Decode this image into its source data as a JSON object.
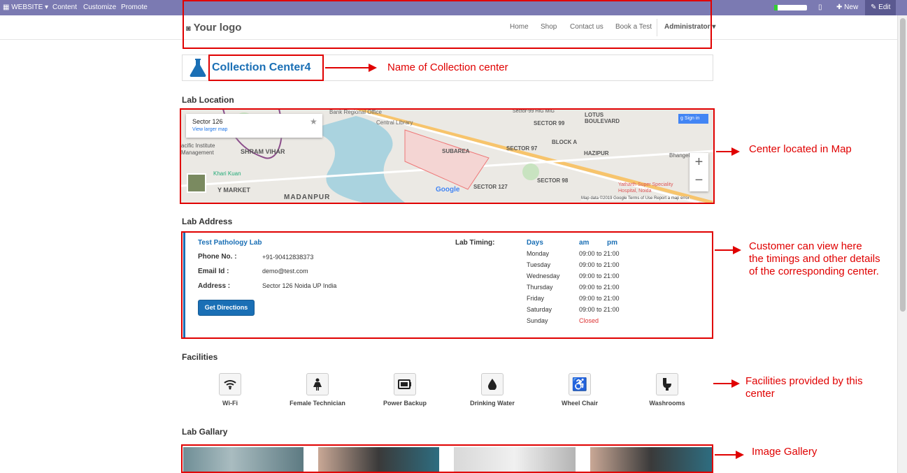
{
  "topbar": {
    "website": "WEBSITE",
    "content": "Content",
    "customize": "Customize",
    "promote": "Promote",
    "new": "New",
    "edit": "Edit"
  },
  "navbar": {
    "logo": "Your logo",
    "links": [
      "Home",
      "Shop",
      "Contact us",
      "Book a Test"
    ],
    "user": "Administrator"
  },
  "center": {
    "name": "Collection Center4"
  },
  "sections": {
    "location": "Lab Location",
    "address": "Lab Address",
    "facilities": "Facilities",
    "gallery": "Lab Gallary"
  },
  "map": {
    "place": "Sector 126",
    "larger": "View larger map",
    "signin": "Sign in",
    "footer": "Map data ©2019 Google   Terms of Use   Report a map error",
    "google": "Google",
    "labels": [
      "SHRAM VIHAR",
      "MADANPUR",
      "SUBAREA",
      "SECTOR 99",
      "SECTOR 97",
      "SECTOR 127",
      "SECTOR 98",
      "BLOCK A",
      "HAZIPUR",
      "LOTUS BOULEVARD",
      "Central Library",
      "Bank Regional Office",
      "Y MARKET",
      "Khari Kuan",
      "Bhangel",
      "Yatharth Super Speciality Hospital, Noida",
      "Sector-99 HIG MIG",
      "acific Institute Management"
    ]
  },
  "address": {
    "lab": "Test Pathology Lab",
    "phone_label": "Phone No. :",
    "phone": "+91-90412838373",
    "email_label": "Email Id :",
    "email": "demo@test.com",
    "addr_label": "Address :",
    "addr": "Sector 126 Noida UP India",
    "directions": "Get Directions",
    "timing_label": "Lab Timing:",
    "days_h": "Days",
    "am_h": "am",
    "pm_h": "pm",
    "timings": [
      {
        "day": "Monday",
        "time": "09:00 to 21:00"
      },
      {
        "day": "Tuesday",
        "time": "09:00 to 21:00"
      },
      {
        "day": "Wednesday",
        "time": "09:00 to 21:00"
      },
      {
        "day": "Thursday",
        "time": "09:00 to 21:00"
      },
      {
        "day": "Friday",
        "time": "09:00 to 21:00"
      },
      {
        "day": "Saturday",
        "time": "09:00 to 21:00"
      },
      {
        "day": "Sunday",
        "time": "Closed"
      }
    ]
  },
  "facilities": [
    {
      "label": "Wi-Fi",
      "icon": "wifi-icon"
    },
    {
      "label": "Female Technician",
      "icon": "female-icon"
    },
    {
      "label": "Power Backup",
      "icon": "battery-icon"
    },
    {
      "label": "Drinking Water",
      "icon": "water-drop-icon"
    },
    {
      "label": "Wheel Chair",
      "icon": "wheelchair-icon"
    },
    {
      "label": "Washrooms",
      "icon": "toilet-icon"
    }
  ],
  "annotations": {
    "name": "Name of Collection center",
    "map": "Center located in Map",
    "address1": "Customer can view here",
    "address2": "the timings and other details",
    "address3": "of the corresponding center.",
    "fac1": "Facilities provided by this",
    "fac2": "center",
    "gallery": "Image Gallery"
  },
  "colors": {
    "topbar": "#7b7ab2",
    "accent": "#1a6fb5",
    "red": "#e00000"
  }
}
